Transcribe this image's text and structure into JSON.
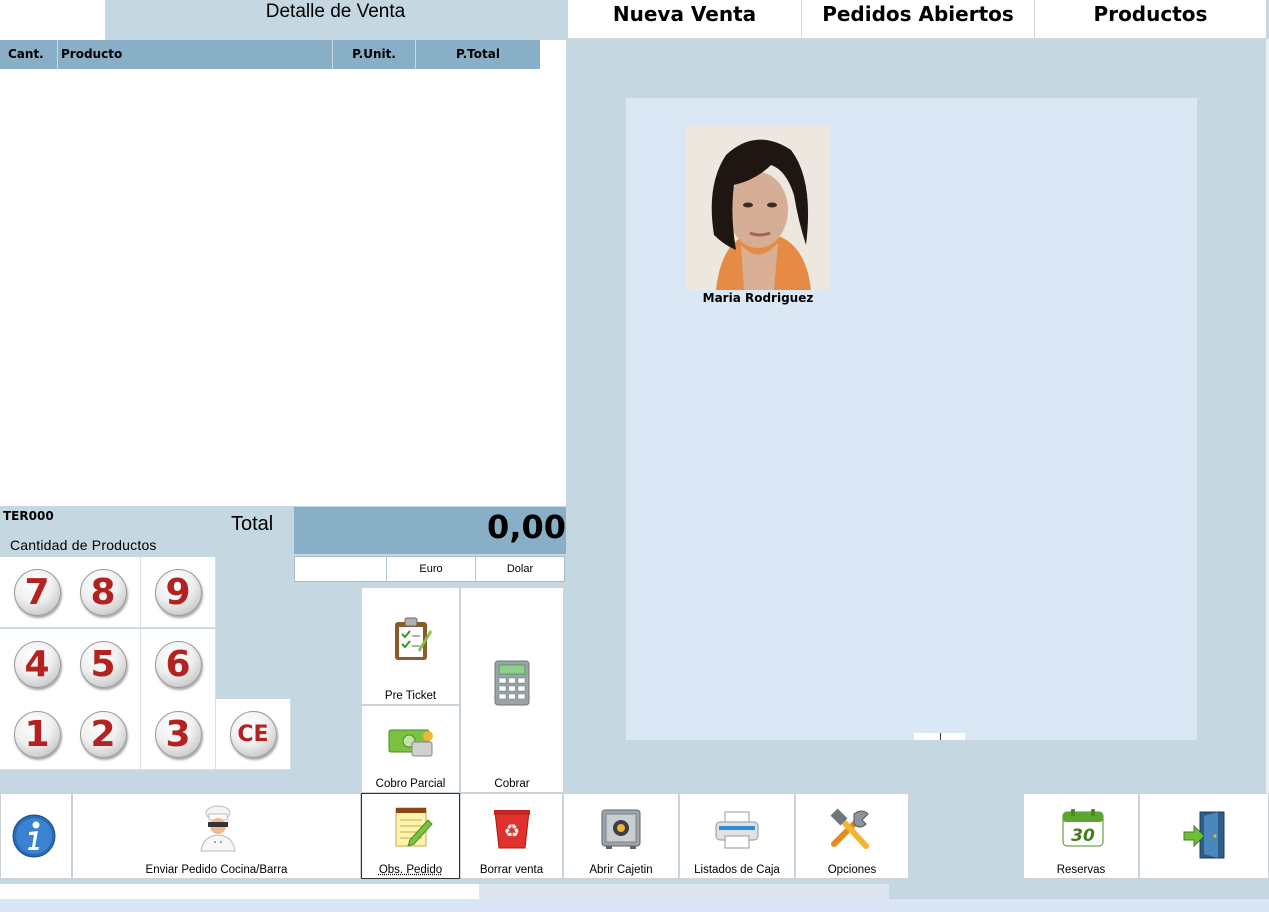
{
  "detail": {
    "title": "Detalle de Venta",
    "columns": {
      "cant": "Cant.",
      "producto": "Producto",
      "punit": "P.Unit.",
      "ptotal": "P.Total"
    },
    "terminal": "TER000",
    "cantidad_label": "Cantidad de Productos",
    "total_label": "Total",
    "total_value": "0,00",
    "currencies": [
      "",
      "Euro",
      "Dolar"
    ]
  },
  "keypad": [
    "7",
    "8",
    "9",
    "4",
    "5",
    "6",
    "1",
    "2",
    "3",
    "CE"
  ],
  "tabs": [
    "Nueva Venta",
    "Pedidos Abiertos",
    "Productos"
  ],
  "waiter": {
    "name": "Maria Rodriguez"
  },
  "actions": {
    "pre_ticket": "Pre Ticket",
    "cobro_parcial": "Cobro Parcial",
    "cobrar": "Cobrar"
  },
  "bottom": {
    "enviar": "Enviar Pedido Cocina/Barra",
    "obs": "Obs. Pedido",
    "borrar": "Borrar venta",
    "abrir": "Abrir Cajetin",
    "listados": "Listados de Caja",
    "opciones": "Opciones",
    "reservas": "Reservas",
    "calendar_day": "30"
  },
  "colors": {
    "header_blue": "#89afc7",
    "panel_blue": "#c5d8e2",
    "card_panel": "#dae7f5",
    "key_red": "#b3221f",
    "info_blue": "#2a6bb8"
  }
}
